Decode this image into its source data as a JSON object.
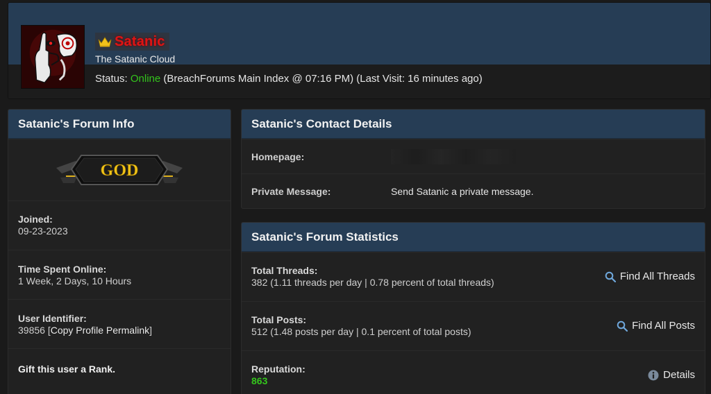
{
  "profile": {
    "username": "Satanic",
    "user_title": "The Satanic Cloud",
    "status_label": "Status:",
    "status_value": "Online",
    "status_detail": "(BreachForums Main Index @ 07:16 PM) (Last Visit: 16 minutes ago)",
    "username_color": "#e01414",
    "crown_icon": "crown-icon",
    "avatar_icon": "avatar-image"
  },
  "forum_info": {
    "title": "Satanic's Forum Info",
    "rank_text": "GOD",
    "joined_label": "Joined:",
    "joined_value": "09-23-2023",
    "online_label": "Time Spent Online:",
    "online_value": "1 Week, 2 Days, 10 Hours",
    "uid_label": "User Identifier:",
    "uid_value": "39856",
    "permalink_open": " [",
    "permalink_text": "Copy Profile Permalink",
    "permalink_close": "]",
    "gift_text": "Gift this user a Rank."
  },
  "contact": {
    "title": "Satanic's Contact Details",
    "homepage_label": "Homepage:",
    "pm_label": "Private Message:",
    "pm_value": "Send Satanic a private message."
  },
  "stats": {
    "title": "Satanic's Forum Statistics",
    "threads_label": "Total Threads:",
    "threads_value": "382 (1.11 threads per day | 0.78 percent of total threads)",
    "threads_action": "Find All Threads",
    "posts_label": "Total Posts:",
    "posts_value": "512 (1.48 posts per day | 0.1 percent of total posts)",
    "posts_action": "Find All Posts",
    "rep_label": "Reputation:",
    "rep_value": "863",
    "rep_action": "Details",
    "online_color": "#34c51c"
  },
  "theme": {
    "header_blue": "#263d55",
    "background": "#1a1a1a",
    "panel": "#212121"
  }
}
